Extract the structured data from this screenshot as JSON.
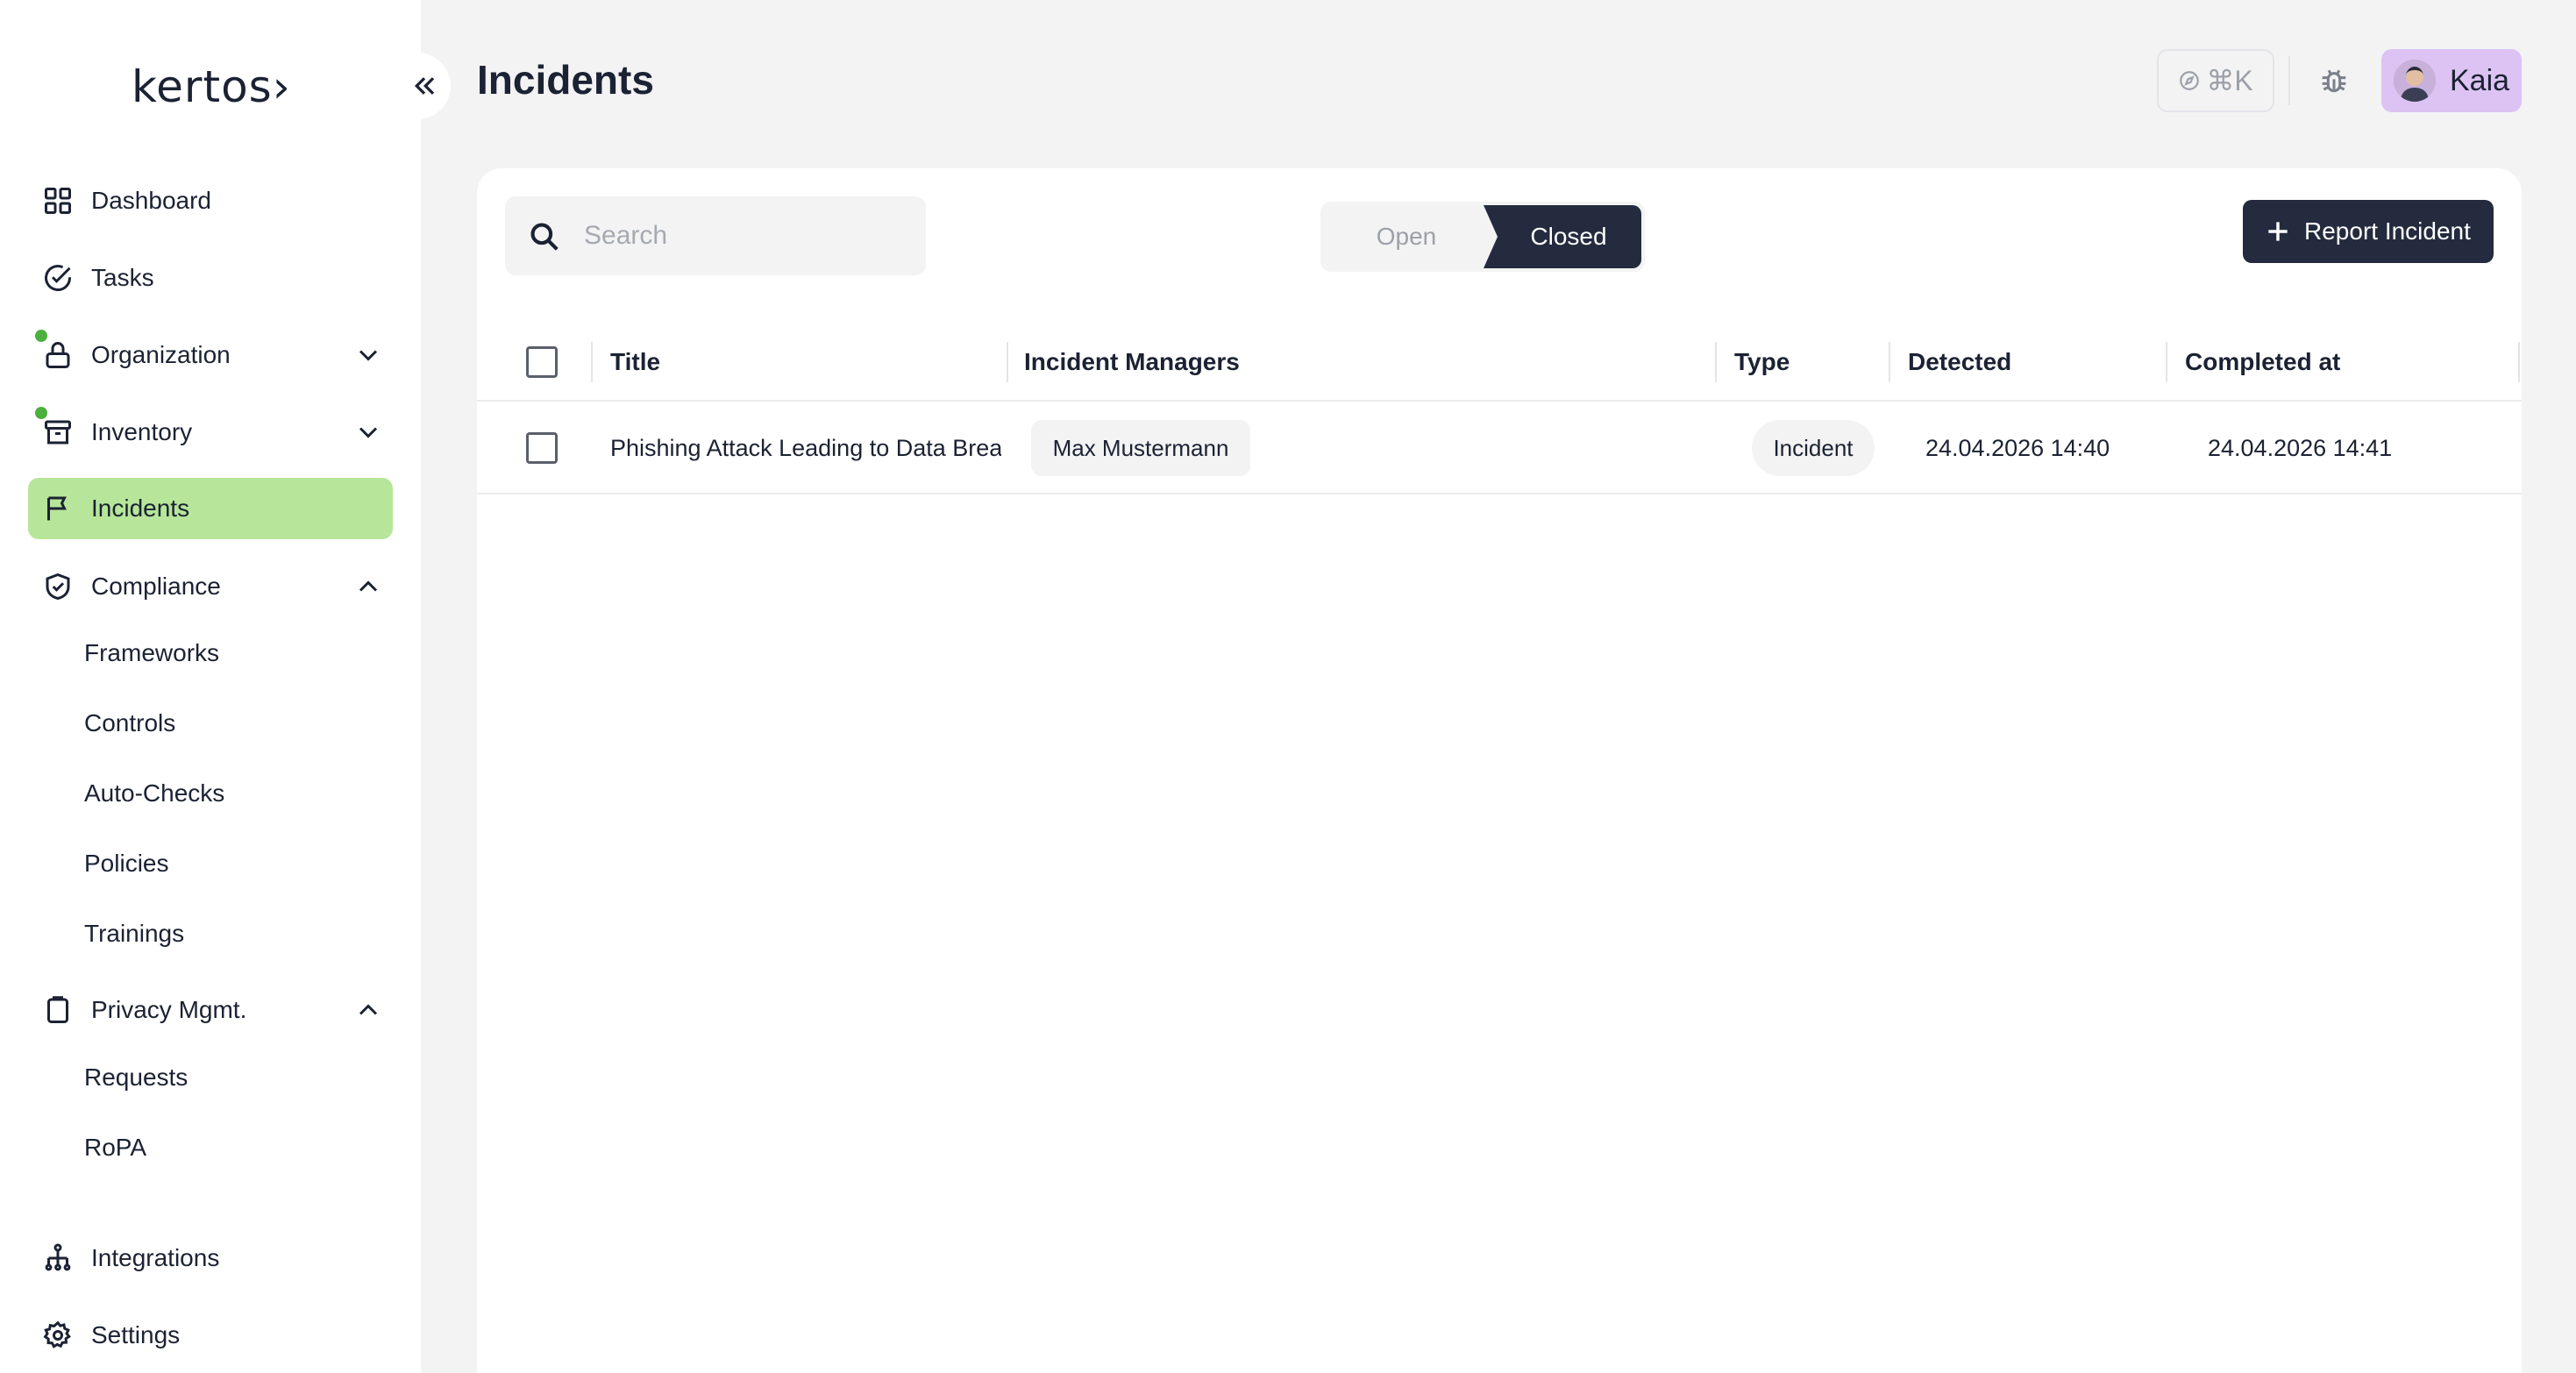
{
  "app": {
    "logo": "kertos›"
  },
  "page": {
    "title": "Incidents"
  },
  "header": {
    "shortcut_label": "⌘K",
    "user_name": "Kaia"
  },
  "sidebar": {
    "items": [
      {
        "label": "Dashboard"
      },
      {
        "label": "Tasks"
      },
      {
        "label": "Organization"
      },
      {
        "label": "Inventory"
      },
      {
        "label": "Incidents"
      },
      {
        "label": "Compliance"
      },
      {
        "label": "Privacy Mgmt."
      },
      {
        "label": "Integrations"
      },
      {
        "label": "Settings"
      }
    ],
    "compliance_sub": [
      {
        "label": "Frameworks"
      },
      {
        "label": "Controls"
      },
      {
        "label": "Auto-Checks"
      },
      {
        "label": "Policies"
      },
      {
        "label": "Trainings"
      }
    ],
    "privacy_sub": [
      {
        "label": "Requests"
      },
      {
        "label": "RoPA"
      }
    ],
    "active": "Incidents",
    "status_dot_color": "#4caf3e",
    "active_bg": "#b7e69a"
  },
  "toolbar": {
    "search_placeholder": "Search",
    "segment_open": "Open",
    "segment_closed": "Closed",
    "segment_selected": "Closed",
    "report_label": "Report Incident"
  },
  "table": {
    "columns": [
      "Title",
      "Incident Managers",
      "Type",
      "Detected",
      "Completed at"
    ],
    "rows": [
      {
        "title": "Phishing Attack Leading to Data Brea",
        "manager": "Max Mustermann",
        "type": "Incident",
        "detected": "24.04.2026 14:40",
        "completed": "24.04.2026 14:41"
      }
    ]
  },
  "colors": {
    "primary_dark": "#242b3e",
    "user_chip": "#dcc3f3",
    "background": "#f3f3f4"
  }
}
